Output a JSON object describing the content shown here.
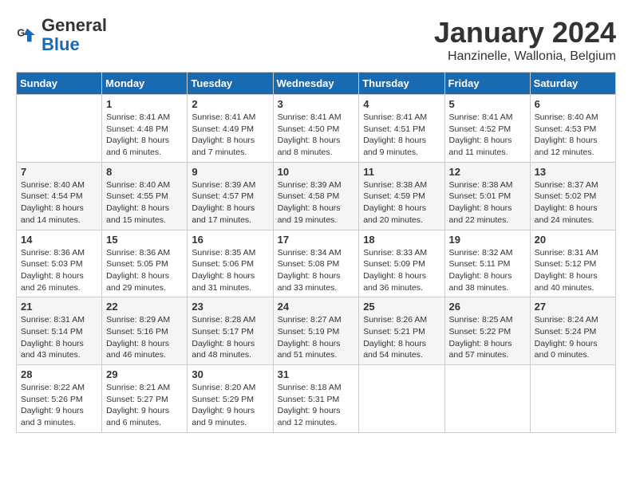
{
  "header": {
    "logo_line1": "General",
    "logo_line2": "Blue",
    "month_title": "January 2024",
    "subtitle": "Hanzinelle, Wallonia, Belgium"
  },
  "weekdays": [
    "Sunday",
    "Monday",
    "Tuesday",
    "Wednesday",
    "Thursday",
    "Friday",
    "Saturday"
  ],
  "weeks": [
    [
      {
        "day": "",
        "sunrise": "",
        "sunset": "",
        "daylight": ""
      },
      {
        "day": "1",
        "sunrise": "Sunrise: 8:41 AM",
        "sunset": "Sunset: 4:48 PM",
        "daylight": "Daylight: 8 hours and 6 minutes."
      },
      {
        "day": "2",
        "sunrise": "Sunrise: 8:41 AM",
        "sunset": "Sunset: 4:49 PM",
        "daylight": "Daylight: 8 hours and 7 minutes."
      },
      {
        "day": "3",
        "sunrise": "Sunrise: 8:41 AM",
        "sunset": "Sunset: 4:50 PM",
        "daylight": "Daylight: 8 hours and 8 minutes."
      },
      {
        "day": "4",
        "sunrise": "Sunrise: 8:41 AM",
        "sunset": "Sunset: 4:51 PM",
        "daylight": "Daylight: 8 hours and 9 minutes."
      },
      {
        "day": "5",
        "sunrise": "Sunrise: 8:41 AM",
        "sunset": "Sunset: 4:52 PM",
        "daylight": "Daylight: 8 hours and 11 minutes."
      },
      {
        "day": "6",
        "sunrise": "Sunrise: 8:40 AM",
        "sunset": "Sunset: 4:53 PM",
        "daylight": "Daylight: 8 hours and 12 minutes."
      }
    ],
    [
      {
        "day": "7",
        "sunrise": "Sunrise: 8:40 AM",
        "sunset": "Sunset: 4:54 PM",
        "daylight": "Daylight: 8 hours and 14 minutes."
      },
      {
        "day": "8",
        "sunrise": "Sunrise: 8:40 AM",
        "sunset": "Sunset: 4:55 PM",
        "daylight": "Daylight: 8 hours and 15 minutes."
      },
      {
        "day": "9",
        "sunrise": "Sunrise: 8:39 AM",
        "sunset": "Sunset: 4:57 PM",
        "daylight": "Daylight: 8 hours and 17 minutes."
      },
      {
        "day": "10",
        "sunrise": "Sunrise: 8:39 AM",
        "sunset": "Sunset: 4:58 PM",
        "daylight": "Daylight: 8 hours and 19 minutes."
      },
      {
        "day": "11",
        "sunrise": "Sunrise: 8:38 AM",
        "sunset": "Sunset: 4:59 PM",
        "daylight": "Daylight: 8 hours and 20 minutes."
      },
      {
        "day": "12",
        "sunrise": "Sunrise: 8:38 AM",
        "sunset": "Sunset: 5:01 PM",
        "daylight": "Daylight: 8 hours and 22 minutes."
      },
      {
        "day": "13",
        "sunrise": "Sunrise: 8:37 AM",
        "sunset": "Sunset: 5:02 PM",
        "daylight": "Daylight: 8 hours and 24 minutes."
      }
    ],
    [
      {
        "day": "14",
        "sunrise": "Sunrise: 8:36 AM",
        "sunset": "Sunset: 5:03 PM",
        "daylight": "Daylight: 8 hours and 26 minutes."
      },
      {
        "day": "15",
        "sunrise": "Sunrise: 8:36 AM",
        "sunset": "Sunset: 5:05 PM",
        "daylight": "Daylight: 8 hours and 29 minutes."
      },
      {
        "day": "16",
        "sunrise": "Sunrise: 8:35 AM",
        "sunset": "Sunset: 5:06 PM",
        "daylight": "Daylight: 8 hours and 31 minutes."
      },
      {
        "day": "17",
        "sunrise": "Sunrise: 8:34 AM",
        "sunset": "Sunset: 5:08 PM",
        "daylight": "Daylight: 8 hours and 33 minutes."
      },
      {
        "day": "18",
        "sunrise": "Sunrise: 8:33 AM",
        "sunset": "Sunset: 5:09 PM",
        "daylight": "Daylight: 8 hours and 36 minutes."
      },
      {
        "day": "19",
        "sunrise": "Sunrise: 8:32 AM",
        "sunset": "Sunset: 5:11 PM",
        "daylight": "Daylight: 8 hours and 38 minutes."
      },
      {
        "day": "20",
        "sunrise": "Sunrise: 8:31 AM",
        "sunset": "Sunset: 5:12 PM",
        "daylight": "Daylight: 8 hours and 40 minutes."
      }
    ],
    [
      {
        "day": "21",
        "sunrise": "Sunrise: 8:31 AM",
        "sunset": "Sunset: 5:14 PM",
        "daylight": "Daylight: 8 hours and 43 minutes."
      },
      {
        "day": "22",
        "sunrise": "Sunrise: 8:29 AM",
        "sunset": "Sunset: 5:16 PM",
        "daylight": "Daylight: 8 hours and 46 minutes."
      },
      {
        "day": "23",
        "sunrise": "Sunrise: 8:28 AM",
        "sunset": "Sunset: 5:17 PM",
        "daylight": "Daylight: 8 hours and 48 minutes."
      },
      {
        "day": "24",
        "sunrise": "Sunrise: 8:27 AM",
        "sunset": "Sunset: 5:19 PM",
        "daylight": "Daylight: 8 hours and 51 minutes."
      },
      {
        "day": "25",
        "sunrise": "Sunrise: 8:26 AM",
        "sunset": "Sunset: 5:21 PM",
        "daylight": "Daylight: 8 hours and 54 minutes."
      },
      {
        "day": "26",
        "sunrise": "Sunrise: 8:25 AM",
        "sunset": "Sunset: 5:22 PM",
        "daylight": "Daylight: 8 hours and 57 minutes."
      },
      {
        "day": "27",
        "sunrise": "Sunrise: 8:24 AM",
        "sunset": "Sunset: 5:24 PM",
        "daylight": "Daylight: 9 hours and 0 minutes."
      }
    ],
    [
      {
        "day": "28",
        "sunrise": "Sunrise: 8:22 AM",
        "sunset": "Sunset: 5:26 PM",
        "daylight": "Daylight: 9 hours and 3 minutes."
      },
      {
        "day": "29",
        "sunrise": "Sunrise: 8:21 AM",
        "sunset": "Sunset: 5:27 PM",
        "daylight": "Daylight: 9 hours and 6 minutes."
      },
      {
        "day": "30",
        "sunrise": "Sunrise: 8:20 AM",
        "sunset": "Sunset: 5:29 PM",
        "daylight": "Daylight: 9 hours and 9 minutes."
      },
      {
        "day": "31",
        "sunrise": "Sunrise: 8:18 AM",
        "sunset": "Sunset: 5:31 PM",
        "daylight": "Daylight: 9 hours and 12 minutes."
      },
      {
        "day": "",
        "sunrise": "",
        "sunset": "",
        "daylight": ""
      },
      {
        "day": "",
        "sunrise": "",
        "sunset": "",
        "daylight": ""
      },
      {
        "day": "",
        "sunrise": "",
        "sunset": "",
        "daylight": ""
      }
    ]
  ]
}
